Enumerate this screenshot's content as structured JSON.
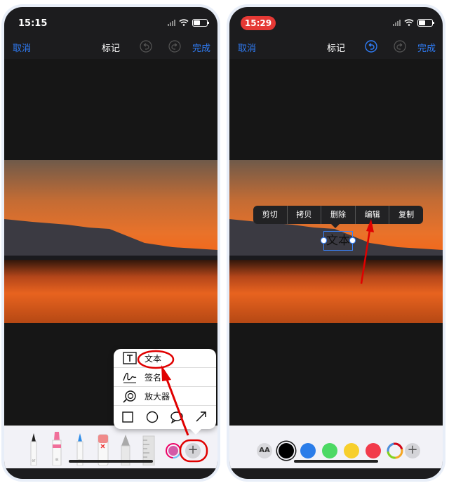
{
  "left_screen": {
    "status": {
      "time": "15:15"
    },
    "nav": {
      "cancel": "取消",
      "title": "标记",
      "done": "完成"
    },
    "popup": {
      "items": [
        {
          "label": "文本",
          "icon": "text-box-icon"
        },
        {
          "label": "签名",
          "icon": "signature-icon"
        },
        {
          "label": "放大器",
          "icon": "magnifier-icon"
        }
      ],
      "shapes": [
        "square-icon",
        "circle-icon",
        "speech-bubble-icon",
        "arrow-icon"
      ]
    },
    "tools": [
      "pen-tool",
      "highlighter-tool",
      "pencil-tool",
      "eraser-tool",
      "lasso-tool",
      "ruler-tool",
      "color-picker",
      "add-button"
    ],
    "tool_numbers": {
      "pen": "97",
      "marker": "44",
      "pencil": "56"
    },
    "plus_label": "+"
  },
  "right_screen": {
    "status": {
      "time": "15:29"
    },
    "nav": {
      "cancel": "取消",
      "title": "标记",
      "done": "完成"
    },
    "context_menu": [
      "剪切",
      "拷贝",
      "删除",
      "编辑",
      "复制"
    ],
    "text_annotation": "文本",
    "aa_label": "AA",
    "plus_label": "+",
    "colors": [
      "#000000",
      "#2b7de9",
      "#4cd964",
      "#f7cf2c",
      "#f23b4b"
    ]
  },
  "accent_color": "#2f7cf6",
  "highlight_color": "#e00000"
}
